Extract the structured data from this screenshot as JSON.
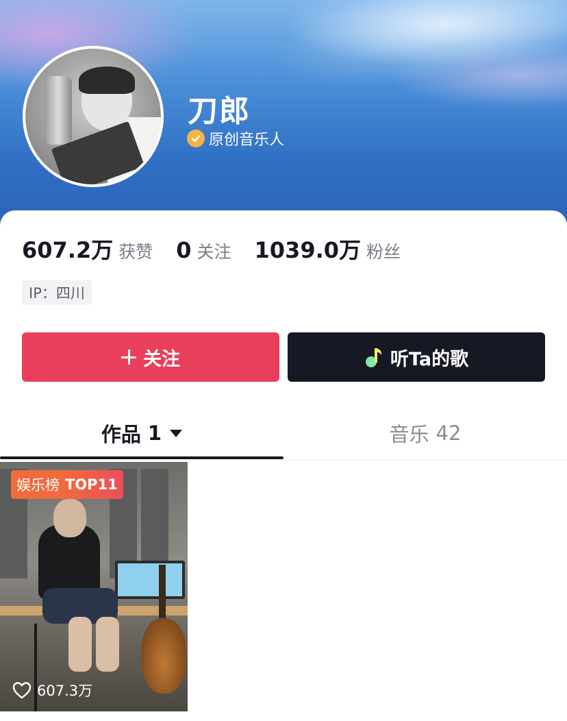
{
  "profile": {
    "name": "刀郎",
    "verify_text": "原创音乐人",
    "avatar_icon": "avatar-photo"
  },
  "stats": [
    {
      "value": "607.2万",
      "label": "获赞"
    },
    {
      "value": "0",
      "label": "关注"
    },
    {
      "value": "1039.0万",
      "label": "粉丝"
    }
  ],
  "ip_tag": "IP：四川",
  "actions": {
    "follow_label": "关注",
    "listen_label": "听Ta的歌"
  },
  "tabs": [
    {
      "label": "作品",
      "count": "1"
    },
    {
      "label": "音乐",
      "count": "42"
    }
  ],
  "videos": [
    {
      "badge_label": "娱乐榜",
      "badge_rank": "TOP11",
      "likes": "607.3万"
    }
  ],
  "colors": {
    "follow_button": "#ea3f5a",
    "listen_button": "#161823",
    "verify_badge": "#f3b540"
  }
}
